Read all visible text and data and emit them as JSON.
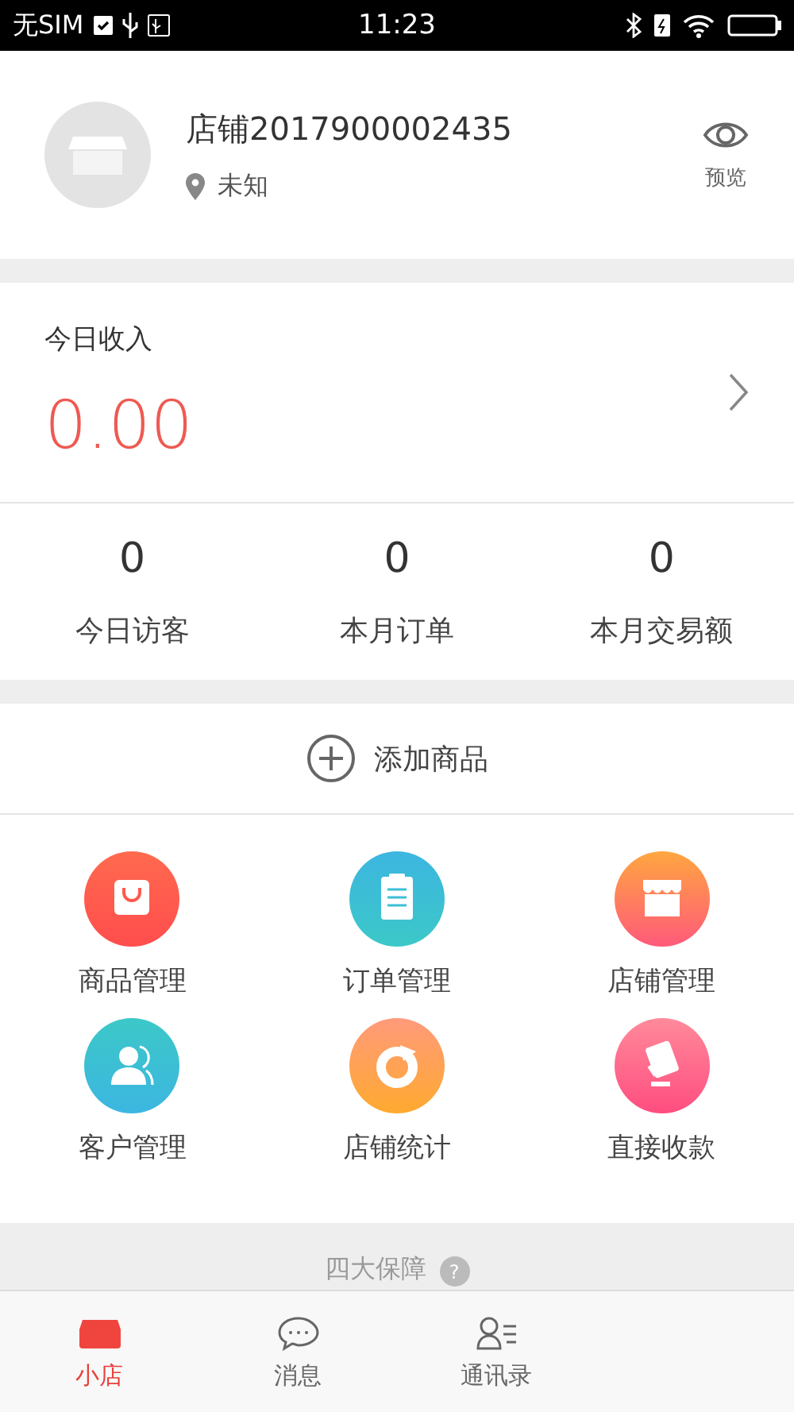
{
  "status_bar": {
    "carrier": "无SIM",
    "time": "11:23"
  },
  "shop": {
    "name": "店铺2017900002435",
    "location": "未知",
    "preview": "预览"
  },
  "income": {
    "label": "今日收入",
    "amount": "0.00"
  },
  "stats": [
    {
      "value": "0",
      "label": "今日访客"
    },
    {
      "value": "0",
      "label": "本月订单"
    },
    {
      "value": "0",
      "label": "本月交易额"
    }
  ],
  "add_product": {
    "label": "添加商品"
  },
  "tools": [
    {
      "kind": "bag",
      "label": "商品管理"
    },
    {
      "kind": "clipboard",
      "label": "订单管理"
    },
    {
      "kind": "store",
      "label": "店铺管理"
    },
    {
      "kind": "people",
      "label": "客户管理"
    },
    {
      "kind": "chart",
      "label": "店铺统计"
    },
    {
      "kind": "payment",
      "label": "直接收款"
    }
  ],
  "guarantee": {
    "label": "四大保障",
    "help": "?"
  },
  "tabs": [
    {
      "kind": "store",
      "label": "小店",
      "selected": true
    },
    {
      "kind": "chat",
      "label": "消息",
      "selected": false
    },
    {
      "kind": "contacts",
      "label": "通讯录",
      "selected": false
    }
  ]
}
